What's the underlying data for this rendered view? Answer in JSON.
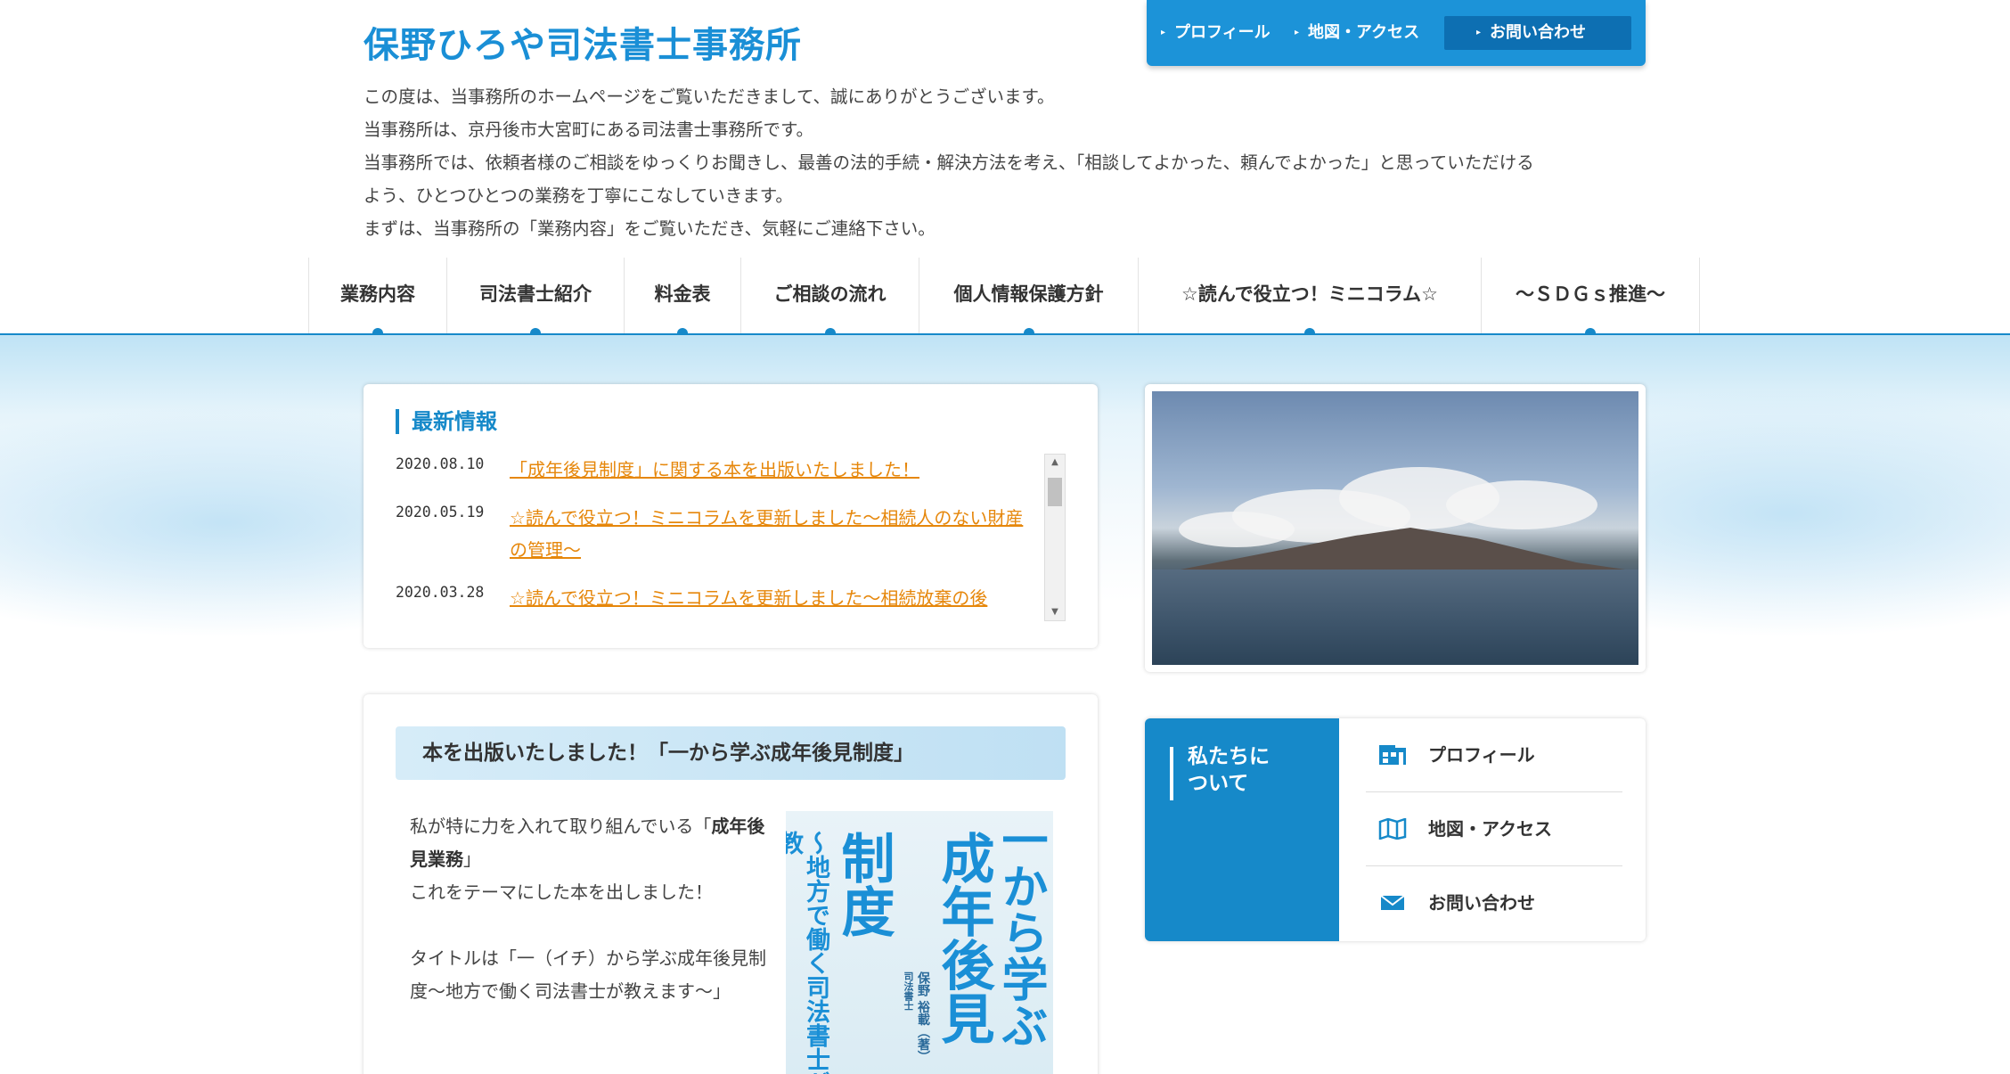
{
  "site": {
    "title": "保野ひろや司法書士事務所"
  },
  "intro": [
    "この度は、当事務所のホームページをご覧いただきまして、誠にありがとうございます。",
    "当事務所は、京丹後市大宮町にある司法書士事務所です。",
    "当事務所では、依頼者様のご相談をゆっくりお聞きし、最善の法的手続・解決方法を考え、「相談してよかった、頼んでよかった」と思っていただける",
    "よう、ひとつひとつの業務を丁寧にこなしていきます。",
    "まずは、当事務所の「業務内容」をご覧いただき、気軽にご連絡下さい。"
  ],
  "top_nav": [
    {
      "label": "プロフィール"
    },
    {
      "label": "地図・アクセス"
    },
    {
      "label": "お問い合わせ"
    }
  ],
  "main_nav": [
    {
      "label": "業務内容"
    },
    {
      "label": "司法書士紹介"
    },
    {
      "label": "料金表"
    },
    {
      "label": "ご相談の流れ"
    },
    {
      "label": "個人情報保護方針"
    },
    {
      "label": "☆読んで役立つ！ミニコラム☆"
    },
    {
      "label": "～ＳＤＧｓ推進～"
    }
  ],
  "news": {
    "title": "最新情報",
    "items": [
      {
        "date": "2020.08.10",
        "text": "「成年後見制度」に関する本を出版いたしました！"
      },
      {
        "date": "2020.05.19",
        "text": "☆読んで役立つ！ミニコラムを更新しました～相続人のない財産の管理～"
      },
      {
        "date": "2020.03.28",
        "text": "☆読んで役立つ！ミニコラムを更新しました～相続放棄の後"
      }
    ]
  },
  "book": {
    "heading": "本を出版いたしました！「一から学ぶ成年後見制度」",
    "p1_prefix": "私が特に力を入れて取り組んでいる「",
    "p1_bold": "成年後見業務",
    "p1_suffix": "」",
    "p2": "これをテーマにした本を出しました！",
    "p3": "タイトルは「一（イチ）から学ぶ成年後見制度～地方で働く司法書士が教えます～」",
    "cover": {
      "col_main_1": "一から学ぶ",
      "col_main_2": "成年後見",
      "col_main_3": "制度",
      "col_sub": "～地方で働く司法書士が教",
      "author_role": "司法書士",
      "author_name": "保野 裕載（著）"
    }
  },
  "about": {
    "title_line1": "私たちに",
    "title_line2": "ついて",
    "items": [
      {
        "label": "プロフィール",
        "icon": "building-icon"
      },
      {
        "label": "地図・アクセス",
        "icon": "map-icon"
      },
      {
        "label": "お問い合わせ",
        "icon": "mail-icon"
      }
    ]
  },
  "colors": {
    "accent": "#1689c9",
    "title": "#1a8fd6",
    "link": "#e6870b"
  }
}
